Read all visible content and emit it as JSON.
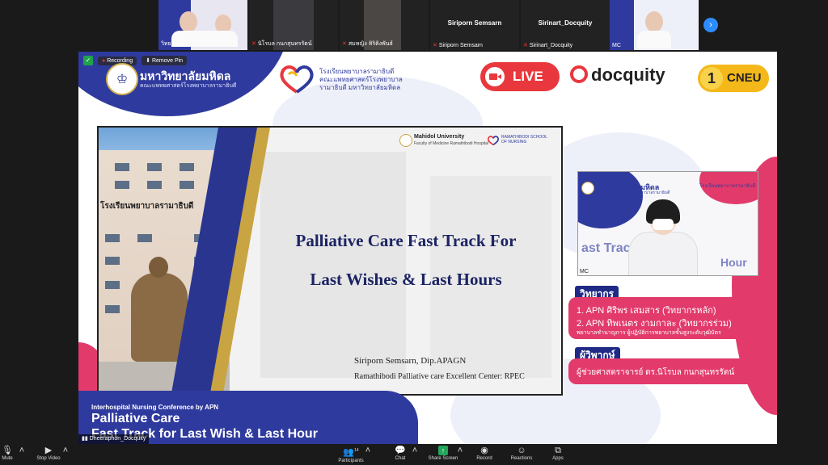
{
  "participants": [
    {
      "name": "วิทยากร",
      "muted": false
    },
    {
      "name": "นิโรบล กนกสุนทรรัตน์",
      "muted": true
    },
    {
      "name": "สมหญิง หิริคิงพันธ์",
      "muted": true
    },
    {
      "name": "Siriporn Semsarn",
      "muted": true
    },
    {
      "name": "Sirinart_Docquity",
      "muted": true
    },
    {
      "name": "MC",
      "muted": false
    }
  ],
  "recording_label": "Recording",
  "remove_pin_label": "Remove Pin",
  "header": {
    "uni_name": "มหาวิทยาลัยมหิดล",
    "uni_sub": "คณะแพทยศาสตร์โรงพยาบาลรามาธิบดี",
    "school_name": "โรงเรียนพยาบาลรามาธิบดี คณะแพทยศาสตร์โรงพยาบาลรามาธิบดี มหาวิทยาลัยมหิดล",
    "live_label": "LIVE",
    "docquity_label": "docquity",
    "cneu_number": "1",
    "cneu_label": "CNEU"
  },
  "slide": {
    "building_sign": "โรงเรียนพยาบาลรามาธิบดี",
    "logo_uni": "Mahidol University",
    "logo_faculty": "Faculty of Medicine Ramathibodi Hospital",
    "logo_school": "RAMATHIBODI SCHOOL OF NURSING",
    "title_line1": "Palliative Care Fast Track For",
    "title_line2": "Last Wishes & Last Hours",
    "author": "Siriporn Semsarn, Dip.APAGN",
    "center": "Ramathibodi Palliative care Excellent Center: RPEC"
  },
  "presenter_video": {
    "uni_name": "มหาวิทยาลัยมหิดล",
    "uni_sub": "คณะแพทยศาสตร์โรงพยาบาลรามาธิบดี",
    "school": "โรงเรียนพยาบาลรามาธิบดี",
    "bg_text1": "ast Track",
    "bg_text2": "Hour",
    "label": "MC"
  },
  "speakers": {
    "heading": "วิทยากร",
    "line1": "1. APN ศิริพร เสมสาร (วิทยากรหลัก)",
    "line2": "2. APN ทิพเนตร งามกาละ (วิทยากรร่วม)",
    "line3": "พยาบาลชำนาญการ ผู้ปฏิบัติการพยาบาลขั้นสูงระดับวุฒิบัตร"
  },
  "critic": {
    "heading": "ผู้วิพากษ์",
    "line1": "ผู้ช่วยศาสตราจารย์ ดร.นิโรบล กนกสุนทรรัตน์"
  },
  "banner": {
    "sub": "Interhospital Nursing Conference by APN",
    "title1": "Palliative Care",
    "title2": "Fast Track for Last Wish & Last Hour"
  },
  "self_view_name": "Dheeraphon_Docquity",
  "toolbar": {
    "mute": "Mute",
    "stop_video": "Stop Video",
    "participants": "Participants",
    "participants_count": "14",
    "chat": "Chat",
    "share_screen": "Share Screen",
    "record": "Record",
    "reactions": "Reactions",
    "apps": "Apps"
  }
}
